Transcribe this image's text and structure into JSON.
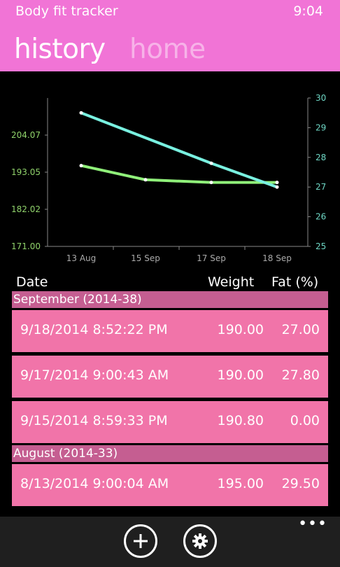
{
  "header": {
    "app_title": "Body fit tracker",
    "time": "9:04",
    "tabs": [
      {
        "label": "history",
        "active": true
      },
      {
        "label": "home",
        "active": false
      }
    ],
    "accent": "#f174d6"
  },
  "chart_data": {
    "type": "line",
    "categories": [
      "13 Aug",
      "15 Sep",
      "17 Sep",
      "18 Sep"
    ],
    "left_axis": {
      "ticks": [
        "171.00",
        "182.02",
        "193.05",
        "204.07"
      ],
      "ylim": [
        171.0,
        215.09
      ],
      "color": "#90d36b"
    },
    "right_axis": {
      "ticks": [
        "25",
        "26",
        "27",
        "28",
        "29",
        "30"
      ],
      "ylim": [
        25,
        30
      ],
      "color": "#6ed6c4"
    },
    "series": [
      {
        "axis": "left",
        "color": "#90f07a",
        "points": [
          [
            "13 Aug",
            195.0
          ],
          [
            "15 Sep",
            190.8
          ],
          [
            "17 Sep",
            190.0
          ],
          [
            "18 Sep",
            190.0
          ]
        ]
      },
      {
        "axis": "right",
        "color": "#79f0e0",
        "points": [
          [
            "13 Aug",
            29.5
          ],
          [
            "17 Sep",
            27.8
          ],
          [
            "18 Sep",
            27.0
          ]
        ]
      }
    ]
  },
  "columns": {
    "date": "Date",
    "weight": "Weight",
    "fat": "Fat (%)"
  },
  "groups": [
    {
      "title": "September (2014-38)",
      "entries": [
        {
          "date": "9/18/2014 8:52:22 PM",
          "weight": "190.00",
          "fat": "27.00"
        },
        {
          "date": "9/17/2014 9:00:43 AM",
          "weight": "190.00",
          "fat": "27.80"
        },
        {
          "date": "9/15/2014 8:59:33 PM",
          "weight": "190.80",
          "fat": "0.00"
        }
      ]
    },
    {
      "title": "August (2014-33)",
      "entries": [
        {
          "date": "8/13/2014 9:00:04 AM",
          "weight": "195.00",
          "fat": "29.50"
        }
      ]
    }
  ],
  "appbar": {
    "icons": [
      "add-icon",
      "settings-icon"
    ],
    "more": "•••"
  }
}
